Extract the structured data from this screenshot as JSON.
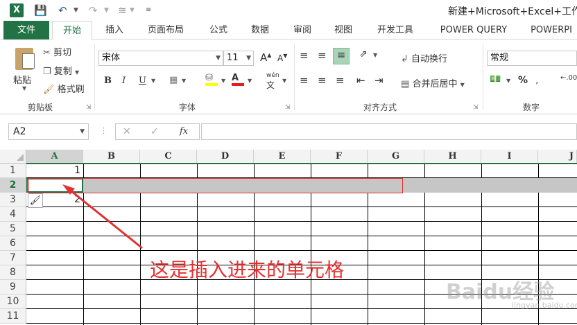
{
  "titlebar": {
    "logo": "X",
    "title": "新建+Microsoft+Excel+工作",
    "qat_icons": [
      "save-icon",
      "undo-icon",
      "redo-icon",
      "chart-icon",
      "customize-icon"
    ]
  },
  "tabs": {
    "file": "文件",
    "home": "开始",
    "insert": "插入",
    "page_layout": "页面布局",
    "formulas": "公式",
    "data": "数据",
    "review": "审阅",
    "view": "视图",
    "developer": "开发工具",
    "power_query": "POWER QUERY",
    "power_pivot": "POWERPI"
  },
  "ribbon": {
    "clipboard": {
      "paste": "粘贴",
      "cut": "剪切",
      "copy": "复制",
      "format_painter": "格式刷",
      "group_label": "剪贴板"
    },
    "font": {
      "font_name": "宋体",
      "font_size": "11",
      "bold": "B",
      "italic": "I",
      "underline": "U",
      "phonetic": "wén",
      "group_label": "字体"
    },
    "alignment": {
      "wrap_text": "自动换行",
      "merge_center": "合并后居中",
      "group_label": "对齐方式"
    },
    "number": {
      "format": "常规",
      "percent": "%",
      "group_label": "数字"
    }
  },
  "formula_bar": {
    "name_box": "A2",
    "fx": "fx",
    "formula": ""
  },
  "sheet": {
    "columns": [
      "A",
      "B",
      "C",
      "D",
      "E",
      "F",
      "G",
      "H",
      "I",
      "J"
    ],
    "rows": [
      "1",
      "2",
      "3",
      "4",
      "5",
      "6",
      "7",
      "8",
      "9",
      "10",
      "11"
    ],
    "cells": {
      "A1": "1",
      "A3": "2"
    },
    "selected_row": "2",
    "active_cell": "A2"
  },
  "annotation": "这是插入进来的单元格",
  "watermark": {
    "main": "Baidu经验",
    "sub": "jingyan.baidu.com"
  },
  "colors": {
    "excel_green": "#217346",
    "annotation_red": "#e53030",
    "selection_gray": "#c6c6c6"
  }
}
